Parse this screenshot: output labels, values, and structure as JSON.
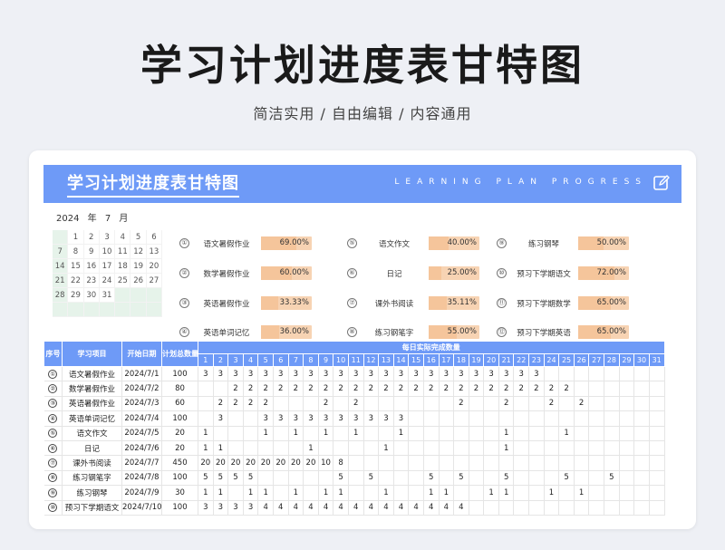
{
  "header": {
    "title": "学习计划进度表甘特图",
    "subtitle": "简洁实用 / 自由编辑 / 内容通用"
  },
  "sheet": {
    "banner_title": "学习计划进度表甘特图",
    "banner_en": "LEARNING PLAN PROGRESS",
    "accent_color": "#6e9af7",
    "bar_color": "#f5c59b",
    "calendar": {
      "year": "2024",
      "year_label": "年",
      "month": "7",
      "month_label": "月",
      "lead_blanks": 1,
      "days_in_month": 31,
      "total_cells": 42
    },
    "tasks": [
      {
        "num": "①",
        "name": "语文暑假作业",
        "percent": "69.00%",
        "value": 69
      },
      {
        "num": "②",
        "name": "数学暑假作业",
        "percent": "60.00%",
        "value": 60
      },
      {
        "num": "③",
        "name": "英语暑假作业",
        "percent": "33.33%",
        "value": 33.33
      },
      {
        "num": "④",
        "name": "英语单词记忆",
        "percent": "36.00%",
        "value": 36
      },
      {
        "num": "⑤",
        "name": "语文作文",
        "percent": "40.00%",
        "value": 40
      },
      {
        "num": "⑥",
        "name": "日记",
        "percent": "25.00%",
        "value": 25
      },
      {
        "num": "⑦",
        "name": "课外书阅读",
        "percent": "35.11%",
        "value": 35.11
      },
      {
        "num": "⑧",
        "name": "练习钢笔字",
        "percent": "55.00%",
        "value": 55
      },
      {
        "num": "⑨",
        "name": "练习钢琴",
        "percent": "50.00%",
        "value": 50
      },
      {
        "num": "⑩",
        "name": "预习下学期语文",
        "percent": "72.00%",
        "value": 72
      },
      {
        "num": "⑪",
        "name": "预习下学期数学",
        "percent": "65.00%",
        "value": 65
      },
      {
        "num": "⑫",
        "name": "预习下学期英语",
        "percent": "65.00%",
        "value": 65
      }
    ],
    "table": {
      "col_seq": "序号",
      "col_project": "学习项目",
      "col_start": "开始日期",
      "col_total": "计划总数量",
      "col_daily": "每日实际完成数量",
      "days": [
        "1",
        "2",
        "3",
        "4",
        "5",
        "6",
        "7",
        "8",
        "9",
        "10",
        "11",
        "12",
        "13",
        "14",
        "15",
        "16",
        "17",
        "18",
        "19",
        "20",
        "21",
        "22",
        "23",
        "24",
        "25",
        "26",
        "27",
        "28",
        "29",
        "30",
        "31"
      ],
      "rows": [
        {
          "seq": "①",
          "project": "语文暑假作业",
          "start": "2024/7/1",
          "total": "100",
          "days": [
            "3",
            "3",
            "3",
            "3",
            "3",
            "3",
            "3",
            "3",
            "3",
            "3",
            "3",
            "3",
            "3",
            "3",
            "3",
            "3",
            "3",
            "3",
            "3",
            "3",
            "3",
            "3",
            "3",
            "",
            "",
            "",
            "",
            "",
            "",
            "",
            ""
          ]
        },
        {
          "seq": "②",
          "project": "数学暑假作业",
          "start": "2024/7/2",
          "total": "80",
          "days": [
            "",
            "",
            "2",
            "2",
            "2",
            "2",
            "2",
            "2",
            "2",
            "2",
            "2",
            "2",
            "2",
            "2",
            "2",
            "2",
            "2",
            "2",
            "2",
            "2",
            "2",
            "2",
            "2",
            "2",
            "2",
            "",
            "",
            "",
            "",
            "",
            ""
          ]
        },
        {
          "seq": "③",
          "project": "英语暑假作业",
          "start": "2024/7/3",
          "total": "60",
          "days": [
            "",
            "2",
            "2",
            "2",
            "2",
            "",
            "",
            "",
            "2",
            "",
            "2",
            "",
            "",
            "",
            "",
            "",
            "",
            "2",
            "",
            "",
            "2",
            "",
            "",
            "2",
            "",
            "2",
            "",
            "",
            "",
            "",
            ""
          ]
        },
        {
          "seq": "④",
          "project": "英语单词记忆",
          "start": "2024/7/4",
          "total": "100",
          "days": [
            "",
            "3",
            "",
            "",
            "3",
            "3",
            "3",
            "3",
            "3",
            "3",
            "3",
            "3",
            "3",
            "3",
            "",
            "",
            "",
            "",
            "",
            "",
            "",
            "",
            "",
            "",
            "",
            "",
            "",
            "",
            "",
            "",
            ""
          ]
        },
        {
          "seq": "⑤",
          "project": "语文作文",
          "start": "2024/7/5",
          "total": "20",
          "days": [
            "1",
            "",
            "",
            "",
            "1",
            "",
            "1",
            "",
            "1",
            "",
            "1",
            "",
            "",
            "1",
            "",
            "",
            "",
            "",
            "",
            "",
            "1",
            "",
            "",
            "",
            "1",
            "",
            "",
            "",
            "",
            "",
            ""
          ]
        },
        {
          "seq": "⑥",
          "project": "日记",
          "start": "2024/7/6",
          "total": "20",
          "days": [
            "1",
            "1",
            "",
            "",
            "",
            "",
            "",
            "1",
            "",
            "",
            "",
            "",
            "1",
            "",
            "",
            "",
            "",
            "",
            "",
            "",
            "1",
            "",
            "",
            "",
            "",
            "",
            "",
            "",
            "",
            "",
            ""
          ]
        },
        {
          "seq": "⑦",
          "project": "课外书阅读",
          "start": "2024/7/7",
          "total": "450",
          "days": [
            "20",
            "20",
            "20",
            "20",
            "20",
            "20",
            "20",
            "20",
            "10",
            "8",
            "",
            "",
            "",
            "",
            "",
            "",
            "",
            "",
            "",
            "",
            "",
            "",
            "",
            "",
            "",
            "",
            "",
            "",
            "",
            "",
            ""
          ]
        },
        {
          "seq": "⑧",
          "project": "练习钢笔字",
          "start": "2024/7/8",
          "total": "100",
          "days": [
            "5",
            "5",
            "5",
            "5",
            "",
            "",
            "",
            "",
            "",
            "5",
            "",
            "5",
            "",
            "",
            "",
            "5",
            "",
            "5",
            "",
            "",
            "5",
            "",
            "",
            "",
            "5",
            "",
            "",
            "5",
            "",
            "",
            ""
          ]
        },
        {
          "seq": "⑨",
          "project": "练习钢琴",
          "start": "2024/7/9",
          "total": "30",
          "days": [
            "1",
            "1",
            "",
            "1",
            "1",
            "",
            "1",
            "",
            "1",
            "1",
            "",
            "",
            "1",
            "",
            "",
            "1",
            "1",
            "",
            "",
            "1",
            "1",
            "",
            "",
            "1",
            "",
            "1",
            "",
            "",
            "",
            "",
            ""
          ]
        },
        {
          "seq": "⑩",
          "project": "预习下学期语文",
          "start": "2024/7/10",
          "total": "100",
          "days": [
            "3",
            "3",
            "3",
            "3",
            "4",
            "4",
            "4",
            "4",
            "4",
            "4",
            "4",
            "4",
            "4",
            "4",
            "4",
            "4",
            "4",
            "4",
            "",
            "",
            "",
            "",
            "",
            "",
            "",
            "",
            "",
            "",
            "",
            "",
            ""
          ]
        }
      ]
    }
  }
}
